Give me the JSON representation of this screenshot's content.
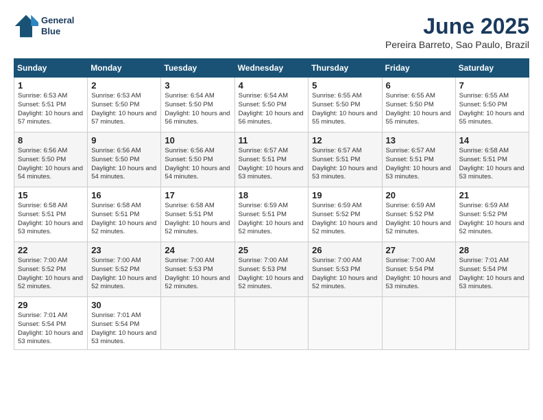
{
  "header": {
    "logo_line1": "General",
    "logo_line2": "Blue",
    "month": "June 2025",
    "location": "Pereira Barreto, Sao Paulo, Brazil"
  },
  "days_of_week": [
    "Sunday",
    "Monday",
    "Tuesday",
    "Wednesday",
    "Thursday",
    "Friday",
    "Saturday"
  ],
  "weeks": [
    [
      {
        "num": "1",
        "sunrise": "6:53 AM",
        "sunset": "5:51 PM",
        "daylight": "10 hours and 57 minutes."
      },
      {
        "num": "2",
        "sunrise": "6:53 AM",
        "sunset": "5:50 PM",
        "daylight": "10 hours and 57 minutes."
      },
      {
        "num": "3",
        "sunrise": "6:54 AM",
        "sunset": "5:50 PM",
        "daylight": "10 hours and 56 minutes."
      },
      {
        "num": "4",
        "sunrise": "6:54 AM",
        "sunset": "5:50 PM",
        "daylight": "10 hours and 56 minutes."
      },
      {
        "num": "5",
        "sunrise": "6:55 AM",
        "sunset": "5:50 PM",
        "daylight": "10 hours and 55 minutes."
      },
      {
        "num": "6",
        "sunrise": "6:55 AM",
        "sunset": "5:50 PM",
        "daylight": "10 hours and 55 minutes."
      },
      {
        "num": "7",
        "sunrise": "6:55 AM",
        "sunset": "5:50 PM",
        "daylight": "10 hours and 55 minutes."
      }
    ],
    [
      {
        "num": "8",
        "sunrise": "6:56 AM",
        "sunset": "5:50 PM",
        "daylight": "10 hours and 54 minutes."
      },
      {
        "num": "9",
        "sunrise": "6:56 AM",
        "sunset": "5:50 PM",
        "daylight": "10 hours and 54 minutes."
      },
      {
        "num": "10",
        "sunrise": "6:56 AM",
        "sunset": "5:50 PM",
        "daylight": "10 hours and 54 minutes."
      },
      {
        "num": "11",
        "sunrise": "6:57 AM",
        "sunset": "5:51 PM",
        "daylight": "10 hours and 53 minutes."
      },
      {
        "num": "12",
        "sunrise": "6:57 AM",
        "sunset": "5:51 PM",
        "daylight": "10 hours and 53 minutes."
      },
      {
        "num": "13",
        "sunrise": "6:57 AM",
        "sunset": "5:51 PM",
        "daylight": "10 hours and 53 minutes."
      },
      {
        "num": "14",
        "sunrise": "6:58 AM",
        "sunset": "5:51 PM",
        "daylight": "10 hours and 53 minutes."
      }
    ],
    [
      {
        "num": "15",
        "sunrise": "6:58 AM",
        "sunset": "5:51 PM",
        "daylight": "10 hours and 53 minutes."
      },
      {
        "num": "16",
        "sunrise": "6:58 AM",
        "sunset": "5:51 PM",
        "daylight": "10 hours and 52 minutes."
      },
      {
        "num": "17",
        "sunrise": "6:58 AM",
        "sunset": "5:51 PM",
        "daylight": "10 hours and 52 minutes."
      },
      {
        "num": "18",
        "sunrise": "6:59 AM",
        "sunset": "5:51 PM",
        "daylight": "10 hours and 52 minutes."
      },
      {
        "num": "19",
        "sunrise": "6:59 AM",
        "sunset": "5:52 PM",
        "daylight": "10 hours and 52 minutes."
      },
      {
        "num": "20",
        "sunrise": "6:59 AM",
        "sunset": "5:52 PM",
        "daylight": "10 hours and 52 minutes."
      },
      {
        "num": "21",
        "sunrise": "6:59 AM",
        "sunset": "5:52 PM",
        "daylight": "10 hours and 52 minutes."
      }
    ],
    [
      {
        "num": "22",
        "sunrise": "7:00 AM",
        "sunset": "5:52 PM",
        "daylight": "10 hours and 52 minutes."
      },
      {
        "num": "23",
        "sunrise": "7:00 AM",
        "sunset": "5:52 PM",
        "daylight": "10 hours and 52 minutes."
      },
      {
        "num": "24",
        "sunrise": "7:00 AM",
        "sunset": "5:53 PM",
        "daylight": "10 hours and 52 minutes."
      },
      {
        "num": "25",
        "sunrise": "7:00 AM",
        "sunset": "5:53 PM",
        "daylight": "10 hours and 52 minutes."
      },
      {
        "num": "26",
        "sunrise": "7:00 AM",
        "sunset": "5:53 PM",
        "daylight": "10 hours and 52 minutes."
      },
      {
        "num": "27",
        "sunrise": "7:00 AM",
        "sunset": "5:54 PM",
        "daylight": "10 hours and 53 minutes."
      },
      {
        "num": "28",
        "sunrise": "7:01 AM",
        "sunset": "5:54 PM",
        "daylight": "10 hours and 53 minutes."
      }
    ],
    [
      {
        "num": "29",
        "sunrise": "7:01 AM",
        "sunset": "5:54 PM",
        "daylight": "10 hours and 53 minutes."
      },
      {
        "num": "30",
        "sunrise": "7:01 AM",
        "sunset": "5:54 PM",
        "daylight": "10 hours and 53 minutes."
      },
      null,
      null,
      null,
      null,
      null
    ]
  ]
}
